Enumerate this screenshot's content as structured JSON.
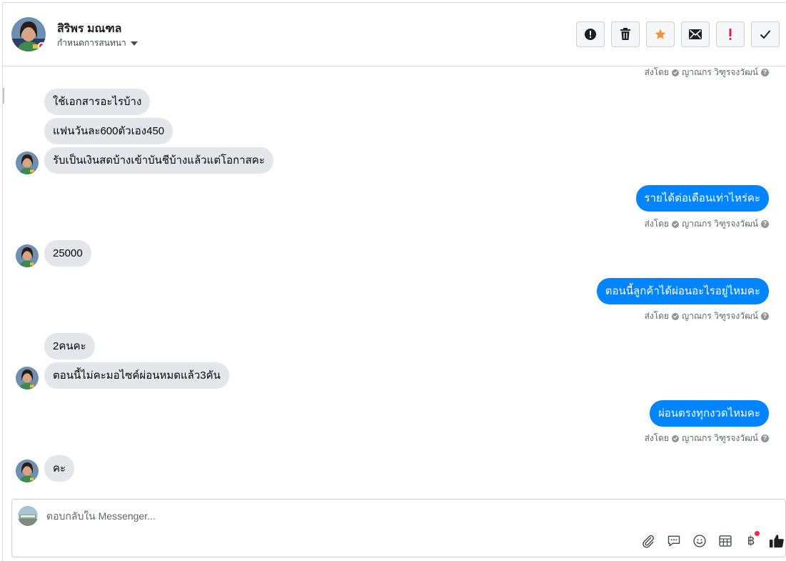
{
  "header": {
    "name": "สิริพร มณฑล",
    "subtitle": "กำหนดการสนทนา",
    "actions": [
      {
        "icon": "exclamation-circle-icon"
      },
      {
        "icon": "trash-icon"
      },
      {
        "icon": "star-icon",
        "color": "#f7923a"
      },
      {
        "icon": "envelope-icon"
      },
      {
        "icon": "exclamation-icon",
        "color": "#e41e3f"
      },
      {
        "icon": "checkmark-icon"
      }
    ]
  },
  "thread": {
    "messages": [
      {
        "sender": "agent",
        "kind": "sent_by",
        "sent_prefix": "ส่งโดย",
        "agent": "ญาณกร วิฑูรจงวัฒน์"
      },
      {
        "sender": "customer",
        "text": "ใช้เอกสารอะไรบ้าง"
      },
      {
        "sender": "customer",
        "text": "แฟนวันละ600ตัวเอง450"
      },
      {
        "sender": "customer",
        "text": "รับเป็นเงินสดบ้างเข้าบันชีบ้างแล้วแต่โอกาสคะ",
        "avatar": true
      },
      {
        "sender": "agent",
        "text": "รายได้ต่อเดือนเท่าไหร่คะ",
        "sent_prefix": "ส่งโดย",
        "agent": "ญาณกร วิฑูรจงวัฒน์"
      },
      {
        "sender": "customer",
        "text": "25000",
        "avatar": true
      },
      {
        "sender": "agent",
        "text": "ตอนนี้ลูกค้าได้ผ่อนอะไรอยู่ไหมคะ",
        "sent_prefix": "ส่งโดย",
        "agent": "ญาณกร วิฑูรจงวัฒน์"
      },
      {
        "sender": "customer",
        "text": "2คนคะ"
      },
      {
        "sender": "customer",
        "text": "ตอนนี้ไม่คะมอไซค์ผ่อนหมดแล้ว3คัน",
        "avatar": true
      },
      {
        "sender": "agent",
        "text": "ผ่อนตรงทุกงวดไหมคะ",
        "sent_prefix": "ส่งโดย",
        "agent": "ญาณกร วิฑูรจงวัฒน์"
      },
      {
        "sender": "customer",
        "text": "คะ",
        "avatar": true
      }
    ]
  },
  "composer": {
    "placeholder": "ตอบกลับใน Messenger...",
    "tools": [
      "paperclip-icon",
      "saved-replies-icon",
      "emoji-icon",
      "calendar-icon",
      "baht-icon",
      "thumbs-up-icon"
    ],
    "baht_symbol": "฿"
  },
  "colors": {
    "outgoing_bubble": "#0084ff",
    "incoming_bubble": "#e4e6eb",
    "accent_star": "#f7923a",
    "alert_red": "#e41e3f"
  }
}
